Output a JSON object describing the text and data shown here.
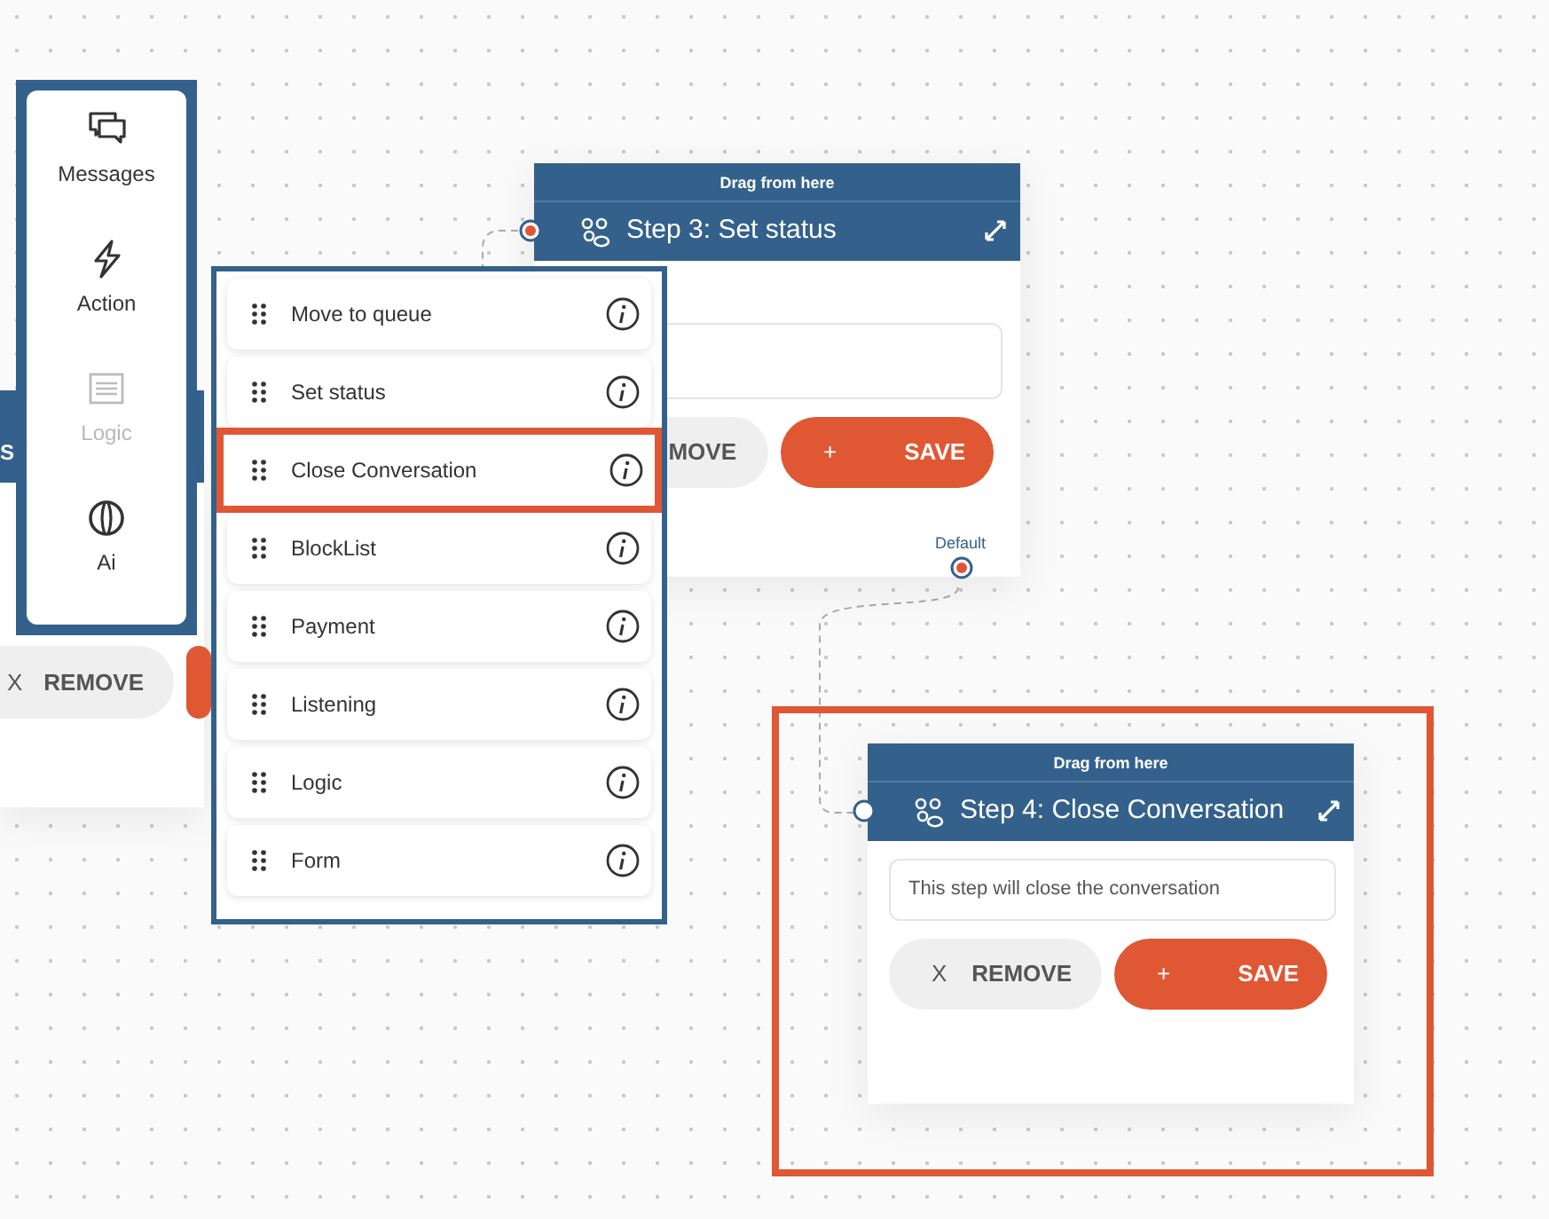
{
  "background_node": {
    "title": "S",
    "remove_icon": "X",
    "remove_label": "REMOVE"
  },
  "sidebar": {
    "items": [
      {
        "label": "Messages",
        "disabled": false
      },
      {
        "label": "Action",
        "disabled": false
      },
      {
        "label": "Logic",
        "disabled": true
      },
      {
        "label": "Ai",
        "disabled": false
      }
    ]
  },
  "nodes": [
    {
      "handle_label": "Drag from here",
      "title": "Step 3: Set status",
      "input_port_active": true,
      "remove_label": "MOVE",
      "save_icon": "+",
      "save_label": "SAVE",
      "output_label": "Default",
      "highlighted": false
    },
    {
      "handle_label": "Drag from here",
      "title": "Step 4: Close Conversation",
      "input_port_active": false,
      "field_text": "This step will close the conversation",
      "remove_icon": "X",
      "remove_label": "REMOVE",
      "save_icon": "+",
      "save_label": "SAVE",
      "highlighted": true
    }
  ],
  "action_menu": {
    "items": [
      {
        "label": "Move to queue",
        "selected": false
      },
      {
        "label": "Set status",
        "selected": false
      },
      {
        "label": "Close Conversation",
        "selected": true
      },
      {
        "label": "BlockList",
        "selected": false
      },
      {
        "label": "Payment",
        "selected": false
      },
      {
        "label": "Listening",
        "selected": false
      },
      {
        "label": "Logic",
        "selected": false
      },
      {
        "label": "Form",
        "selected": false
      }
    ]
  }
}
